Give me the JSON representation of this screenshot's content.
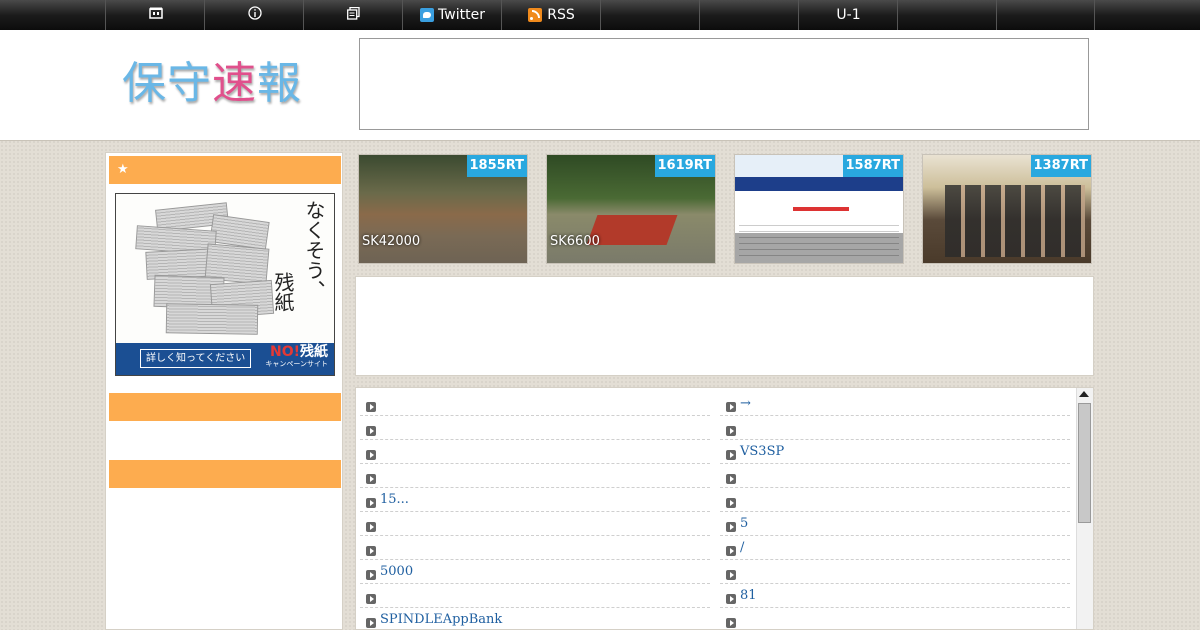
{
  "nav": {
    "items": [
      {
        "label": "",
        "icon": "home-icon"
      },
      {
        "label": "",
        "icon": "info-icon"
      },
      {
        "label": "",
        "icon": "archive-icon"
      },
      {
        "label": "Twitter",
        "icon": "twitter-icon"
      },
      {
        "label": "RSS",
        "icon": "rss-icon"
      },
      {
        "label": ""
      },
      {
        "label": ""
      },
      {
        "label": "U-1"
      },
      {
        "label": ""
      },
      {
        "label": ""
      }
    ]
  },
  "header": {
    "logo_part1": "保守",
    "logo_part2": "速",
    "logo_part3": "報"
  },
  "sidebar": {
    "sections": [
      {
        "title": "★"
      },
      {
        "title": ""
      },
      {
        "title": ""
      }
    ],
    "banner": {
      "vertical_text_1": "なくそう、",
      "vertical_text_2": "残紙",
      "button_label": "詳しく知ってください",
      "no_label": "NO!",
      "no_label_2": "残紙",
      "campaign_label": "キャンペーンサイト"
    }
  },
  "thumbnails": [
    {
      "rt": "1855RT",
      "caption": "SK42000"
    },
    {
      "rt": "1619RT",
      "caption": "SK6600"
    },
    {
      "rt": "1587RT",
      "caption": ""
    },
    {
      "rt": "1387RT",
      "caption": ""
    }
  ],
  "list": {
    "left": [
      "",
      "",
      "",
      "",
      "15...",
      "",
      "",
      " 5000",
      "",
      "SPINDLEAppBank"
    ],
    "right": [
      "→",
      "",
      "VS3SP",
      "",
      "",
      "5",
      " /",
      "",
      "81",
      ""
    ]
  },
  "colors": {
    "accent": "#fdac4f",
    "rt_badge": "#29a8df",
    "link": "#1f5fa0"
  }
}
